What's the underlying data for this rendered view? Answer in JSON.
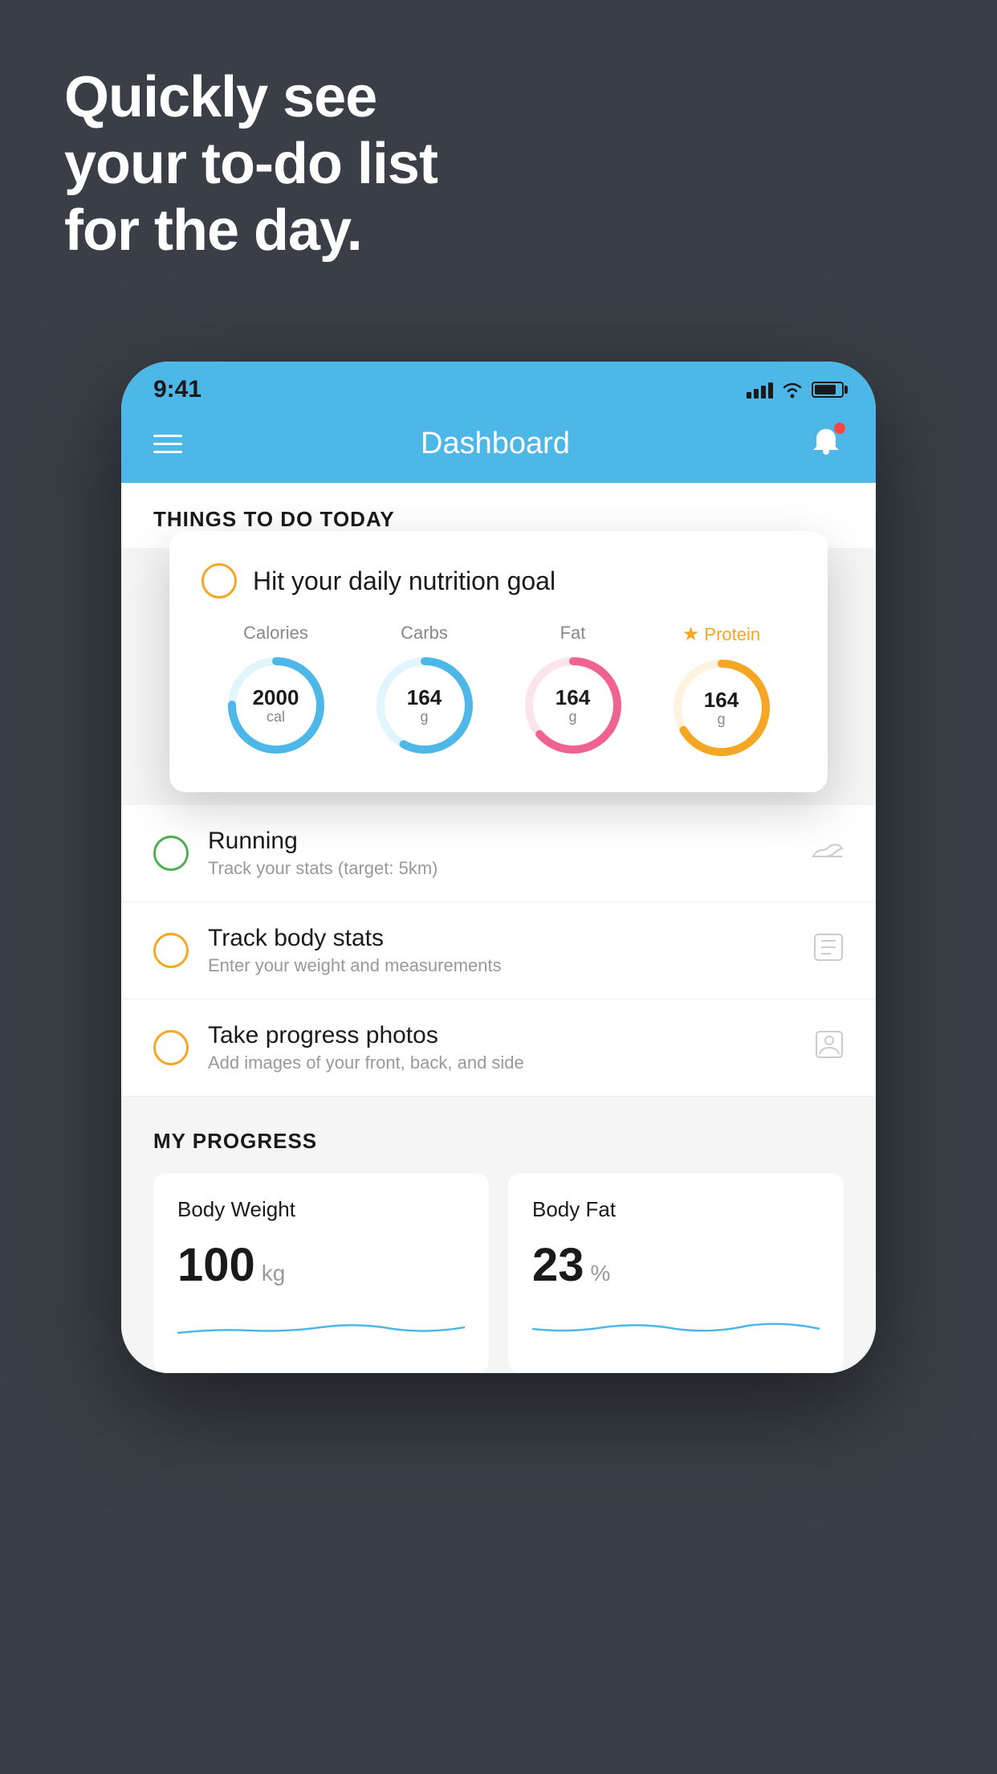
{
  "headline": {
    "line1": "Quickly see",
    "line2": "your to-do list",
    "line3": "for the day."
  },
  "status_bar": {
    "time": "9:41",
    "signal_bars": [
      8,
      12,
      16,
      20,
      24
    ],
    "wifi": "wifi",
    "battery": "battery"
  },
  "header": {
    "title": "Dashboard"
  },
  "things_to_do": {
    "section_title": "THINGS TO DO TODAY",
    "nutrition_card": {
      "title": "Hit your daily nutrition goal",
      "items": [
        {
          "label": "Calories",
          "value": "2000",
          "unit": "cal",
          "color": "#4db8e8",
          "trail": "#e0f5fc"
        },
        {
          "label": "Carbs",
          "value": "164",
          "unit": "g",
          "color": "#4db8e8",
          "trail": "#e0f5fc"
        },
        {
          "label": "Fat",
          "value": "164",
          "unit": "g",
          "color": "#f06292",
          "trail": "#fce4ec"
        },
        {
          "label": "Protein",
          "value": "164",
          "unit": "g",
          "color": "#f5a623",
          "trail": "#fff3e0",
          "star": true
        }
      ]
    },
    "todo_items": [
      {
        "name": "Running",
        "description": "Track your stats (target: 5km)",
        "check_style": "green",
        "icon": "shoe"
      },
      {
        "name": "Track body stats",
        "description": "Enter your weight and measurements",
        "check_style": "yellow",
        "icon": "scale"
      },
      {
        "name": "Take progress photos",
        "description": "Add images of your front, back, and side",
        "check_style": "yellow",
        "icon": "photo"
      }
    ]
  },
  "progress": {
    "section_title": "MY PROGRESS",
    "cards": [
      {
        "title": "Body Weight",
        "value": "100",
        "unit": "kg"
      },
      {
        "title": "Body Fat",
        "value": "23",
        "unit": "%"
      }
    ]
  }
}
